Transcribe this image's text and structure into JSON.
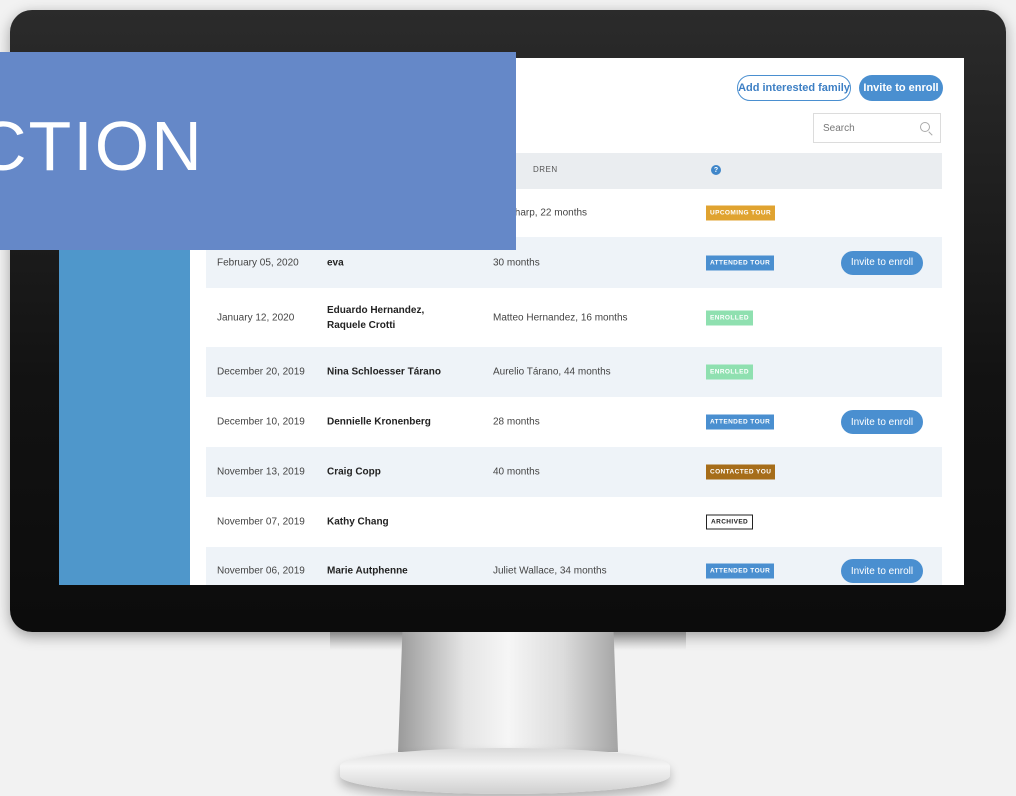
{
  "header": {
    "add_family_label": "Add interested family",
    "invite_label": "Invite to enroll",
    "search_placeholder": "Search"
  },
  "table": {
    "columns": {
      "children": "DREN"
    },
    "rows": [
      {
        "date": "",
        "name": "",
        "children": "thy Sharp, 22 months",
        "status": "UPCOMING TOUR",
        "status_color": "#e0a330",
        "status_text_color": "#ffffff",
        "action": ""
      },
      {
        "date": "February 05, 2020",
        "name": "eva",
        "children": "30 months",
        "status": "ATTENDED TOUR",
        "status_color": "#4a8fd0",
        "status_text_color": "#ffffff",
        "action": "Invite to enroll"
      },
      {
        "date": "January 12, 2020",
        "name": "Eduardo Hernandez,\nRaquele Crotti",
        "children": "Matteo Hernandez, 16 months",
        "status": "ENROLLED",
        "status_color": "#8fe0b0",
        "status_text_color": "#ffffff",
        "action": ""
      },
      {
        "date": "December 20, 2019",
        "name": "Nina Schloesser Tárano",
        "children": "Aurelio Tárano, 44 months",
        "status": "ENROLLED",
        "status_color": "#8fe0b0",
        "status_text_color": "#ffffff",
        "action": ""
      },
      {
        "date": "December 10, 2019",
        "name": "Dennielle Kronenberg",
        "children": "28 months",
        "status": "ATTENDED TOUR",
        "status_color": "#4a8fd0",
        "status_text_color": "#ffffff",
        "action": "Invite to enroll"
      },
      {
        "date": "November 13, 2019",
        "name": "Craig Copp",
        "children": "40 months",
        "status": "CONTACTED YOU",
        "status_color": "#a66d1a",
        "status_text_color": "#ffffff",
        "action": ""
      },
      {
        "date": "November 07, 2019",
        "name": "Kathy Chang",
        "children": "",
        "status": "ARCHIVED",
        "status_color": "#ffffff",
        "status_text_color": "#222222",
        "action": ""
      },
      {
        "date": "November 06, 2019",
        "name": "Marie Autphenne",
        "children": "Juliet Wallace, 34 months",
        "status": "ATTENDED TOUR",
        "status_color": "#4a8fd0",
        "status_text_color": "#ffffff",
        "action": "Invite to enroll"
      }
    ]
  },
  "banner": {
    "text": "CTION"
  },
  "colors": {
    "sidebar": "#4f97cb",
    "banner": "#6588c8",
    "accent": "#4a8fd0"
  }
}
